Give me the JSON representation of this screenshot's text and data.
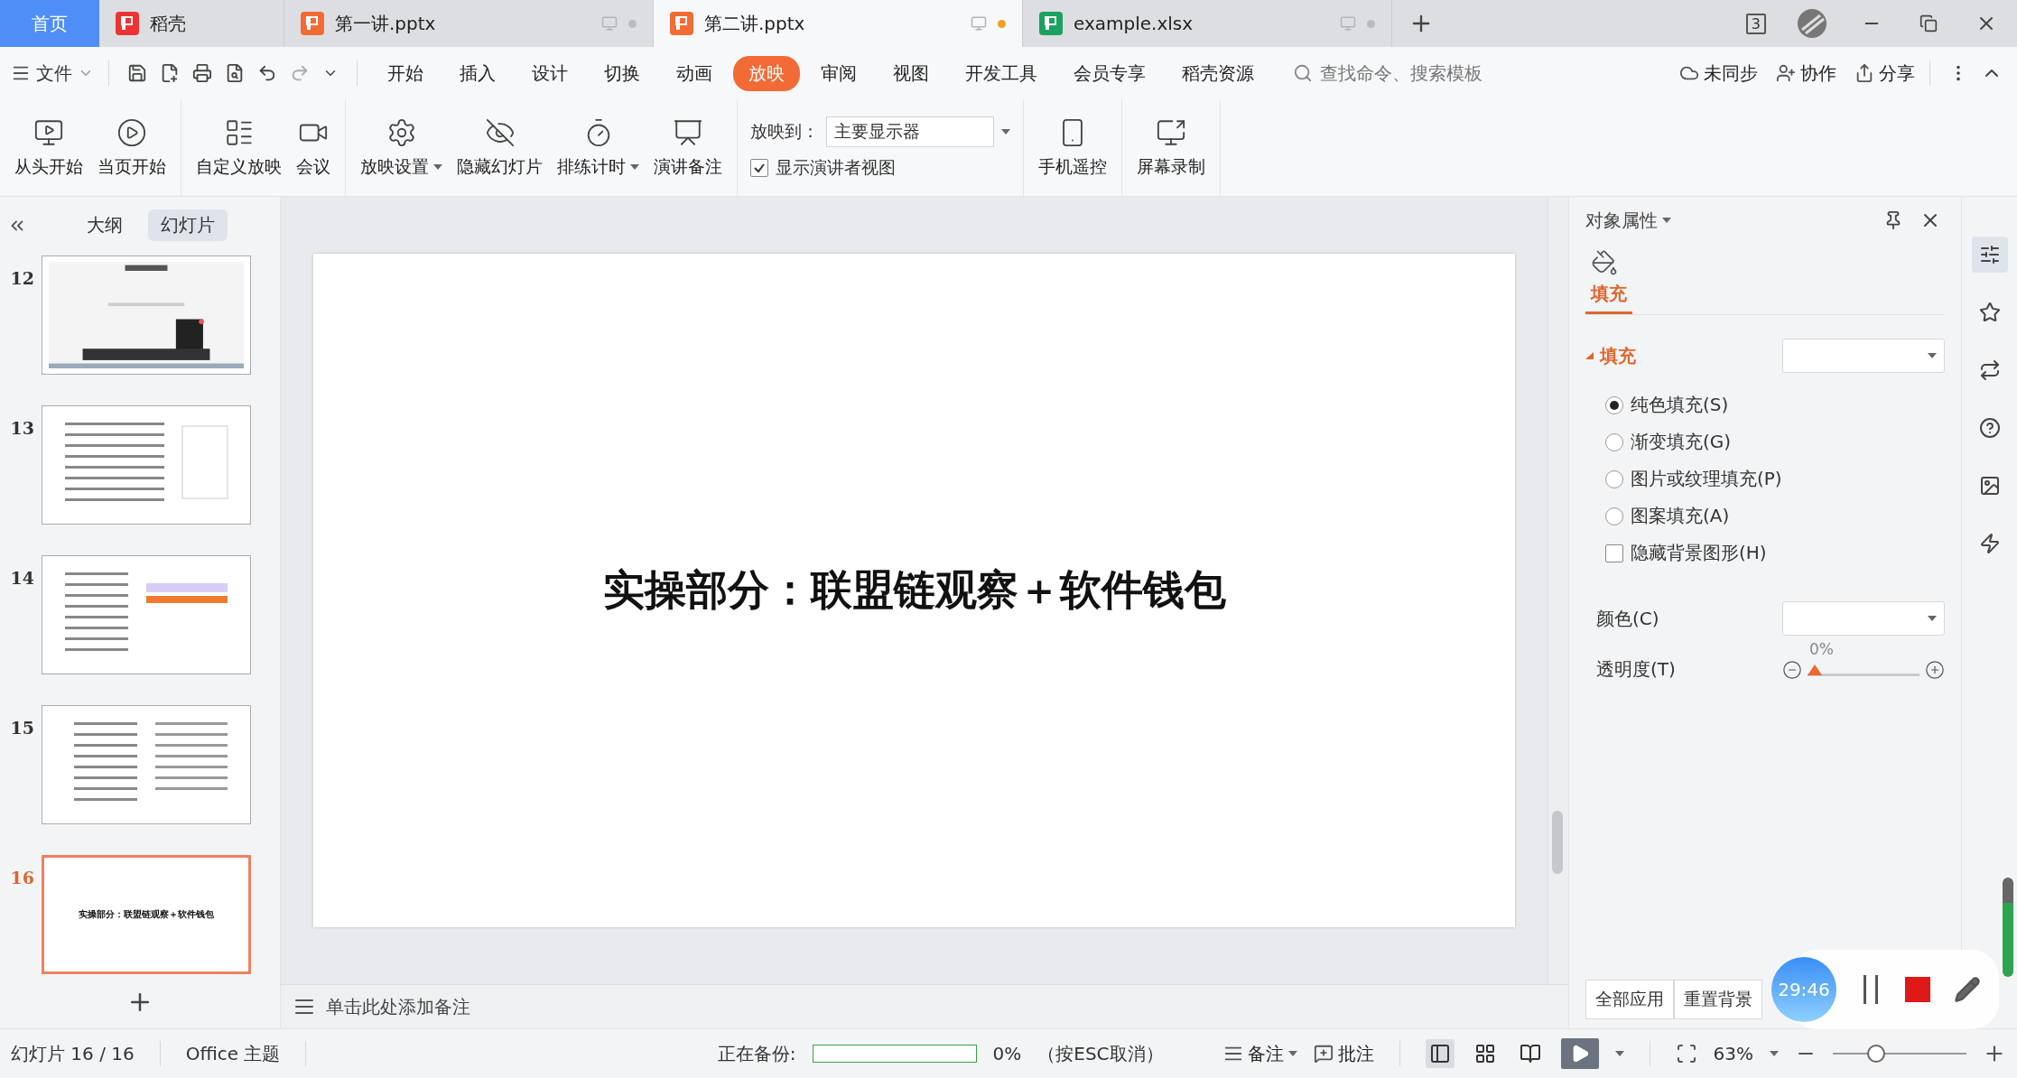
{
  "tabs": [
    {
      "label": "首页",
      "kind": "home",
      "selected": false
    },
    {
      "label": "稻壳",
      "kind": "docer",
      "selected": false
    },
    {
      "label": "第一讲.pptx",
      "kind": "ppt",
      "selected": false,
      "unsaved": false
    },
    {
      "label": "第二讲.pptx",
      "kind": "ppt",
      "selected": true,
      "unsaved": true
    },
    {
      "label": "example.xlsx",
      "kind": "xls",
      "selected": false,
      "unsaved": false
    }
  ],
  "window_count": "3",
  "menu": {
    "file": "文件",
    "items": [
      {
        "label": "开始",
        "selected": false
      },
      {
        "label": "插入",
        "selected": false
      },
      {
        "label": "设计",
        "selected": false
      },
      {
        "label": "切换",
        "selected": false
      },
      {
        "label": "动画",
        "selected": false
      },
      {
        "label": "放映",
        "selected": true
      },
      {
        "label": "审阅",
        "selected": false
      },
      {
        "label": "视图",
        "selected": false
      },
      {
        "label": "开发工具",
        "selected": false
      },
      {
        "label": "会员专享",
        "selected": false
      },
      {
        "label": "稻壳资源",
        "selected": false
      }
    ],
    "search_placeholder": "查找命令、搜索模板",
    "actions": [
      {
        "label": "未同步",
        "kind": "sync"
      },
      {
        "label": "协作",
        "kind": "collab"
      },
      {
        "label": "分享",
        "kind": "share"
      }
    ]
  },
  "ribbon": [
    {
      "kind": "buttons",
      "items": [
        {
          "label": "从头开始",
          "kind": "from-start",
          "dropdown": false
        },
        {
          "label": "当页开始",
          "kind": "current",
          "dropdown": false
        }
      ]
    },
    {
      "kind": "buttons",
      "items": [
        {
          "label": "自定义放映",
          "kind": "custom",
          "dropdown": false
        },
        {
          "label": "会议",
          "kind": "meeting",
          "dropdown": false
        }
      ]
    },
    {
      "kind": "buttons",
      "items": [
        {
          "label": "放映设置",
          "kind": "settings",
          "dropdown": true
        },
        {
          "label": "隐藏幻灯片",
          "kind": "hide",
          "dropdown": false
        },
        {
          "label": "排练计时",
          "kind": "timing",
          "dropdown": true
        },
        {
          "label": "演讲备注",
          "kind": "notes",
          "dropdown": false
        }
      ]
    },
    {
      "kind": "output",
      "label": "放映到：",
      "value": "主要显示器",
      "checkbox": {
        "label": "显示演讲者视图",
        "checked": true
      }
    },
    {
      "kind": "buttons",
      "items": [
        {
          "label": "手机遥控",
          "kind": "phone",
          "dropdown": false
        }
      ]
    },
    {
      "kind": "buttons",
      "items": [
        {
          "label": "屏幕录制",
          "kind": "record",
          "dropdown": false
        }
      ]
    }
  ],
  "outline_tabs": [
    {
      "label": "大纲",
      "selected": false
    },
    {
      "label": "幻灯片",
      "selected": true
    }
  ],
  "slides": [
    {
      "number": "12",
      "kind": "picture",
      "selected": false
    },
    {
      "number": "13",
      "kind": "text",
      "selected": false
    },
    {
      "number": "14",
      "kind": "form",
      "selected": false
    },
    {
      "number": "15",
      "kind": "columns",
      "selected": false
    },
    {
      "number": "16",
      "kind": "title",
      "selected": true,
      "title": "实操部分：联盟链观察＋软件钱包"
    }
  ],
  "slide": {
    "title": "实操部分：联盟链观察＋软件钱包"
  },
  "notes": {
    "placeholder": "单击此处添加备注"
  },
  "properties": {
    "title": "对象属性",
    "tabs": [
      {
        "label": "填充",
        "selected": true
      }
    ],
    "section": {
      "label": "填充",
      "expanded": true
    },
    "options": [
      {
        "kind": "radio",
        "label": "纯色填充(S)",
        "selected": true
      },
      {
        "kind": "radio",
        "label": "渐变填充(G)",
        "selected": false
      },
      {
        "kind": "radio",
        "label": "图片或纹理填充(P)",
        "selected": false
      },
      {
        "kind": "radio",
        "label": "图案填充(A)",
        "selected": false
      },
      {
        "kind": "checkbox",
        "label": "隐藏背景图形(H)",
        "checked": false
      }
    ],
    "color_label": "颜色(C)",
    "transparency": {
      "label": "透明度(T)",
      "reading": "0%",
      "level": 0
    },
    "buttons": [
      "全部应用",
      "重置背景"
    ]
  },
  "recorder": {
    "time": "29:46"
  },
  "status": {
    "slide_count": "幻灯片 16 / 16",
    "theme": "Office 主题",
    "backup": {
      "label": "正在备份:",
      "level": 0,
      "reading": "0%",
      "hint": "（按ESC取消）"
    },
    "notes": "备注",
    "comments": "批注",
    "views": [
      {
        "kind": "normal",
        "selected": true
      },
      {
        "kind": "sorter",
        "selected": false
      },
      {
        "kind": "reading",
        "selected": false
      }
    ],
    "zoom": {
      "reading": "63%",
      "level": 0.3
    }
  }
}
